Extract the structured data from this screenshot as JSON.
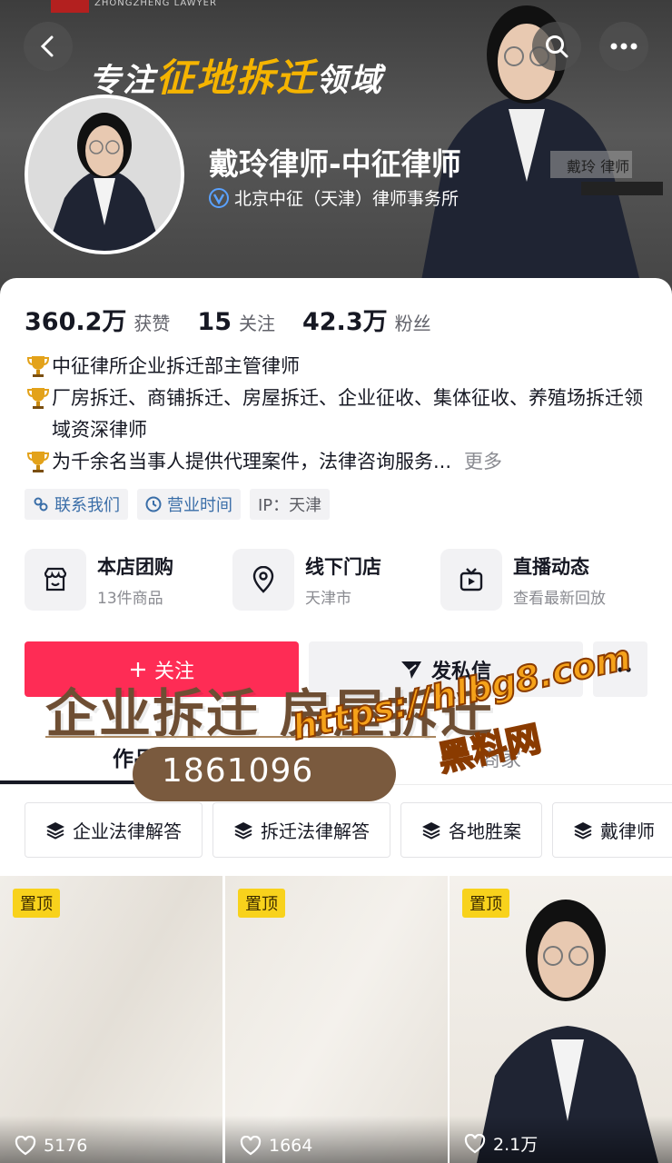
{
  "banner": {
    "logo_text": "ZHONGZHENG LAWYER",
    "slogan_prefix": "专注",
    "slogan_highlight": "征地拆迁",
    "slogan_suffix": "领域",
    "name_tag": "戴玲 律师"
  },
  "profile": {
    "name": "戴玲律师-中征律师",
    "verification": "北京中征（天津）律师事务所"
  },
  "stats": [
    {
      "value": "360.2万",
      "label": "获赞"
    },
    {
      "value": "15",
      "label": "关注"
    },
    {
      "value": "42.3万",
      "label": "粉丝"
    }
  ],
  "bio": {
    "line1": "中征律所企业拆迁部主管律师",
    "line2": "厂房拆迁、商铺拆迁、房屋拆迁、企业征收、集体征收、养殖场拆迁领域资深律师",
    "line3": "为千余名当事人提供代理案件，法律咨询服务...",
    "more": "更多"
  },
  "tags": {
    "contact": "联系我们",
    "hours": "营业时间",
    "ip": "IP：天津"
  },
  "services": [
    {
      "title": "本店团购",
      "sub": "13件商品",
      "icon": "store-icon"
    },
    {
      "title": "线下门店",
      "sub": "天津市",
      "icon": "location-pin-icon"
    },
    {
      "title": "直播动态",
      "sub": "查看最新回放",
      "icon": "tv-icon"
    }
  ],
  "actions": {
    "follow": "关注",
    "message": "发私信"
  },
  "tabs": {
    "works": "作品 1347",
    "shop": "商家"
  },
  "collections": [
    "企业法律解答",
    "拆迁法律解答",
    "各地胜案",
    "戴律师"
  ],
  "videos": [
    {
      "pin": "置顶",
      "likes": "5176"
    },
    {
      "pin": "置顶",
      "likes": "1664"
    },
    {
      "pin": "置顶",
      "likes": "2.1万"
    }
  ],
  "cover": {
    "title": "企业拆迁 房屋拆迁",
    "phone": "1861096"
  },
  "watermark": {
    "url": "https://hlbg8.com",
    "cn": "黑料网"
  },
  "colors": {
    "accent": "#fe2c55",
    "pin": "#f8d21c",
    "slogan_highlight": "#f5b400",
    "link_blue": "#3a6ea8"
  }
}
